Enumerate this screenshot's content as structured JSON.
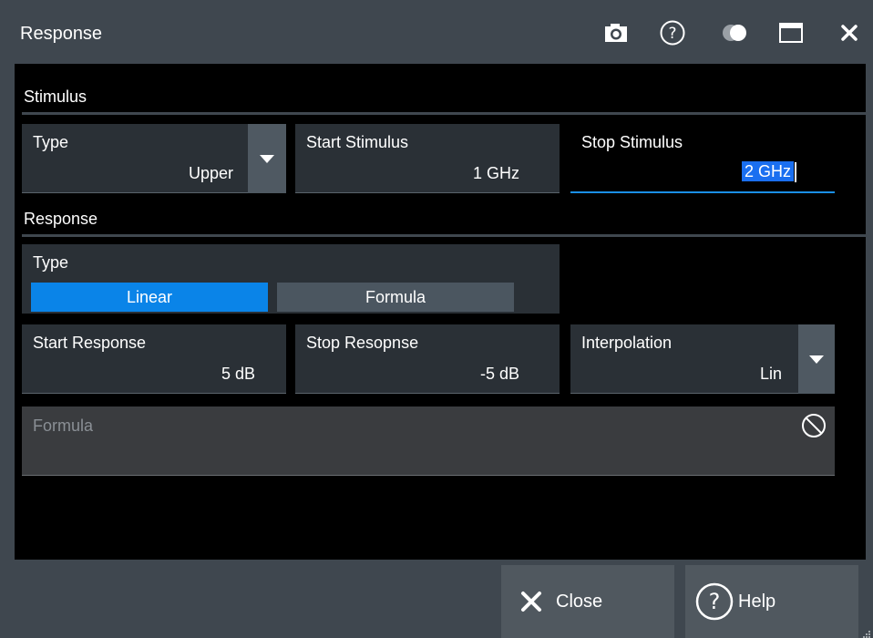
{
  "window": {
    "title": "Response",
    "icons": [
      "camera-icon",
      "help-icon",
      "transparency-icon",
      "maximize-icon",
      "close-icon"
    ]
  },
  "stimulus": {
    "section_label": "Stimulus",
    "type": {
      "label": "Type",
      "value": "Upper"
    },
    "start": {
      "label": "Start Stimulus",
      "value": "1 GHz"
    },
    "stop": {
      "label": "Stop Stimulus",
      "value": "2 GHz"
    }
  },
  "response": {
    "section_label": "Response",
    "type": {
      "label": "Type",
      "options": [
        "Linear",
        "Formula"
      ],
      "selected": "Linear"
    },
    "start": {
      "label": "Start Response",
      "value": "5 dB"
    },
    "stop": {
      "label": "Stop Resopnse",
      "value": "-5 dB"
    },
    "interpolation": {
      "label": "Interpolation",
      "value": "Lin"
    },
    "formula": {
      "placeholder": "Formula",
      "value": ""
    }
  },
  "footer": {
    "close_label": "Close",
    "help_label": "Help"
  },
  "colors": {
    "accent": "#0a84e8",
    "selection": "#1a6ff0",
    "panel": "#3f474f",
    "field": "#2a3036"
  }
}
